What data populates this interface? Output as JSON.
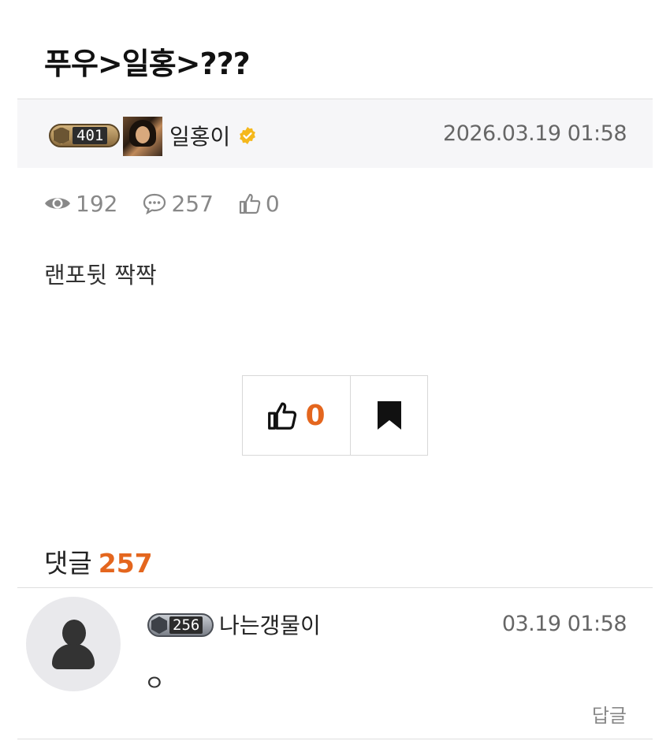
{
  "post": {
    "title": "푸우>일홍>???",
    "author": {
      "level": "401",
      "name": "일홍이",
      "verified": true
    },
    "date": "2026.03.19 01:58",
    "stats": {
      "views": "192",
      "comments": "257",
      "likes": "0"
    },
    "body": "랜포뒷 짝짝",
    "actions": {
      "like_count": "0"
    }
  },
  "comments": {
    "label": "댓글",
    "count": "257",
    "items": [
      {
        "level": "256",
        "author": "나는갱물이",
        "date": "03.19 01:58",
        "text": "ㅇ",
        "reply_label": "답글"
      }
    ]
  },
  "colors": {
    "accent": "#e4661e",
    "verified": "#f5b81c",
    "muted": "#888888"
  },
  "icons": {
    "views": "eye-icon",
    "comments": "comment-icon",
    "likes": "thumbs-up-icon",
    "bookmark": "bookmark-icon",
    "verified": "verified-badge-icon"
  }
}
